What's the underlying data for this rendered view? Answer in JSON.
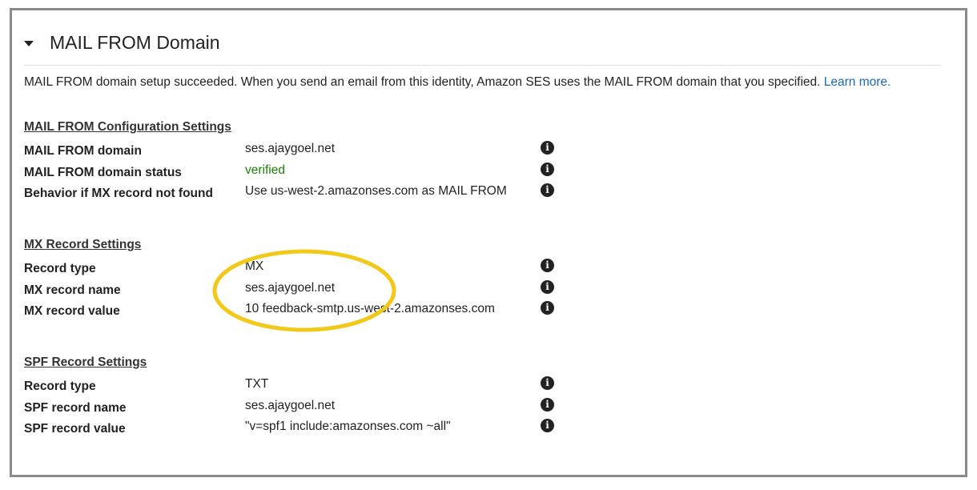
{
  "panel": {
    "title": "MAIL FROM Domain",
    "description": "MAIL FROM domain setup succeeded. When you send an email from this identity, Amazon SES uses the MAIL FROM domain that you specified. ",
    "learn_more": "Learn more."
  },
  "sections": {
    "config": {
      "title": "MAIL FROM Configuration Settings",
      "rows": [
        {
          "label": "MAIL FROM domain",
          "value": "ses.ajaygoel.net"
        },
        {
          "label": "MAIL FROM domain status",
          "value": "verified"
        },
        {
          "label": "Behavior if MX record not found",
          "value": "Use us-west-2.amazonses.com as MAIL FROM"
        }
      ]
    },
    "mx": {
      "title": "MX Record Settings",
      "rows": [
        {
          "label": "Record type",
          "value": "MX"
        },
        {
          "label": "MX record name",
          "value": "ses.ajaygoel.net"
        },
        {
          "label": "MX record value",
          "value": "10 feedback-smtp.us-west-2.amazonses.com"
        }
      ]
    },
    "spf": {
      "title": "SPF Record Settings",
      "rows": [
        {
          "label": "Record type",
          "value": "TXT"
        },
        {
          "label": "SPF record name",
          "value": "ses.ajaygoel.net"
        },
        {
          "label": "SPF record value",
          "value": "\"v=spf1 include:amazonses.com ~all\""
        }
      ]
    }
  },
  "icons": {
    "info": "i"
  },
  "colors": {
    "link": "#1a66b8",
    "verified": "#1d8102",
    "highlight": "#f2c919"
  }
}
